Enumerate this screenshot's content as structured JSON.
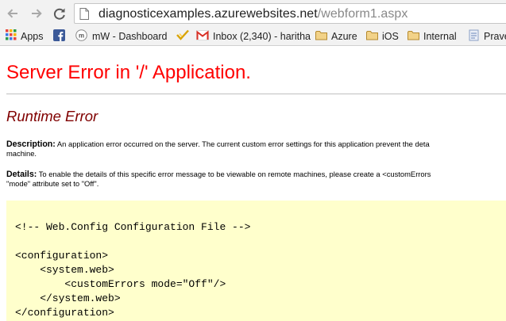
{
  "browser": {
    "nav": {
      "back_icon": "back-arrow-icon",
      "forward_icon": "forward-arrow-icon",
      "reload_icon": "reload-icon"
    },
    "url_host": "diagnosticexamples.azurewebsites.net",
    "url_path": "/webform1.aspx"
  },
  "bookmarks": [
    {
      "label": "Apps",
      "icon": "apps-grid-icon"
    },
    {
      "label": "",
      "icon": "facebook-icon"
    },
    {
      "label": "mW - Dashboard",
      "icon": "mw-icon"
    },
    {
      "label": "",
      "icon": "checkmark-icon"
    },
    {
      "label": "Inbox (2,340) - haritha",
      "icon": "gmail-icon"
    },
    {
      "label": "Azure",
      "icon": "folder-icon"
    },
    {
      "label": "iOS",
      "icon": "folder-icon"
    },
    {
      "label": "Internal",
      "icon": "folder-icon"
    },
    {
      "label": "Prave",
      "icon": "bookmark-page-icon"
    }
  ],
  "page": {
    "title": "Server Error in '/' Application.",
    "subtitle": "Runtime Error",
    "description_label": "Description:",
    "description_line1": "An application error occurred on the server. The current custom error settings for this application prevent the deta",
    "description_line2": "machine.",
    "details_label": "Details:",
    "details_line1": "To enable the details of this specific error message to be viewable on remote machines, please create a <customErrors",
    "details_line2": "\"mode\" attribute set to \"Off\".",
    "code_lines": [
      "<!-- Web.Config Configuration File -->",
      "",
      "<configuration>",
      "    <system.web>",
      "        <customErrors mode=\"Off\"/>",
      "    </system.web>",
      "</configuration>"
    ]
  },
  "colors": {
    "title": "#ff0000",
    "subtitle": "#800000",
    "config_background": "#ffffcc",
    "chrome_background": "#f2f2f2"
  }
}
